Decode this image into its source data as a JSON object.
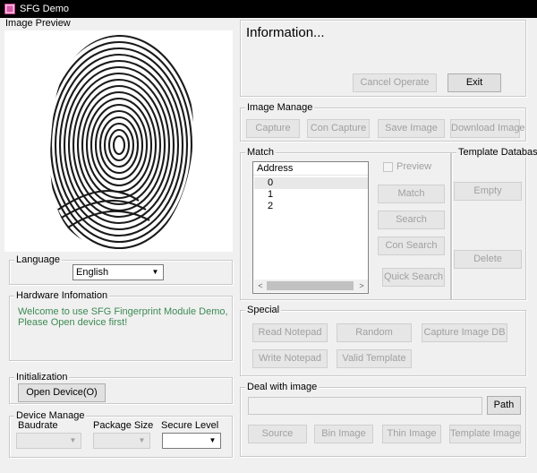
{
  "window": {
    "title": "SFG Demo"
  },
  "preview": {
    "label": "Image Preview"
  },
  "info": {
    "title": "Information...",
    "cancel_label": "Cancel Operate",
    "exit_label": "Exit"
  },
  "language": {
    "label": "Language",
    "selected": "English"
  },
  "hardware": {
    "label": "Hardware Infomation",
    "line1": "Welcome to use SFG Fingerprint Module Demo,",
    "line2": "Please Open device first!"
  },
  "init": {
    "label": "Initialization",
    "open_label": "Open Device(O)"
  },
  "device": {
    "label": "Device Manage",
    "baudrate_label": "Baudrate",
    "package_label": "Package Size",
    "secure_label": "Secure Level"
  },
  "image_manage": {
    "label": "Image Manage",
    "buttons": [
      "Capture",
      "Con Capture",
      "Save Image",
      "Download Image"
    ]
  },
  "match": {
    "label": "Match",
    "list_header": "Address",
    "rows": [
      "0",
      "1",
      "2"
    ],
    "preview_label": "Preview",
    "buttons": [
      "Match",
      "Search",
      "Con Search",
      "Quick Search"
    ]
  },
  "template_db": {
    "label": "Template Database",
    "empty_label": "Empty",
    "delete_label": "Delete"
  },
  "special": {
    "label": "Special",
    "buttons": [
      "Read Notepad",
      "Random",
      "Capture Image DB",
      "Write Notepad",
      "Valid Template"
    ]
  },
  "deal": {
    "label": "Deal with image",
    "path_label": "Path",
    "buttons": [
      "Source",
      "Bin Image",
      "Thin Image",
      "Template Image"
    ]
  },
  "colors": {
    "titlebar": "#000000",
    "status_text": "#3c8a54",
    "disabled_text": "#a0a0a0"
  }
}
